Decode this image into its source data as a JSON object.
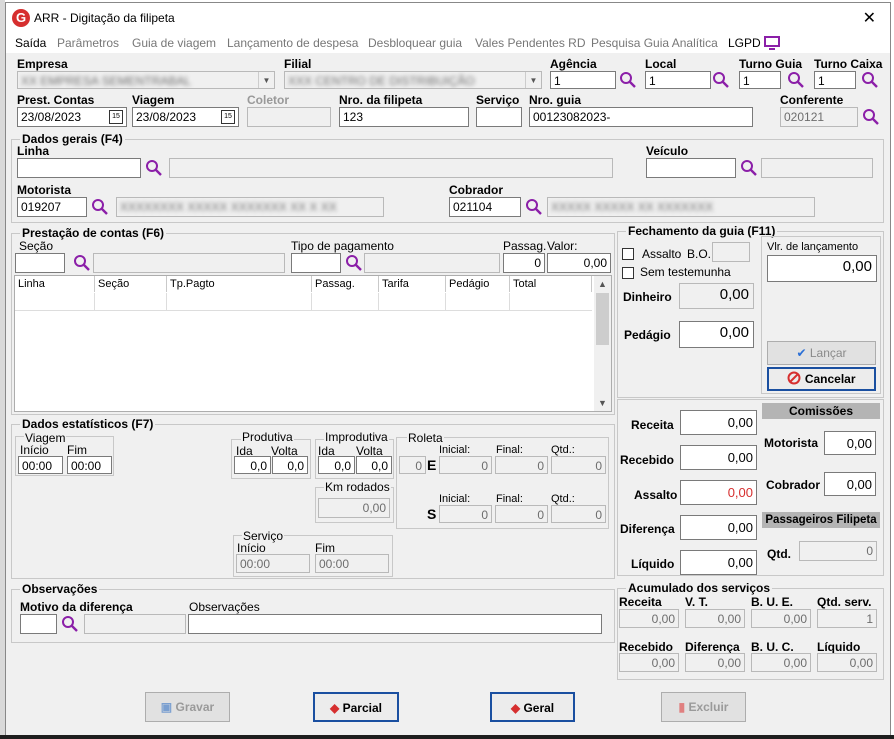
{
  "window": {
    "title": "ARR - Digitação da filipeta",
    "close": "✕"
  },
  "menu": [
    "Saída",
    "Parâmetros",
    "Guia de viagem",
    "Lançamento de despesa",
    "Desbloquear guia",
    "Vales Pendentes RD",
    "Pesquisa Guia Analítica",
    "LGPD"
  ],
  "header": {
    "empresa_label": "Empresa",
    "empresa_value": "XX EMPRESA SEMENTRABAL",
    "filial_label": "Filial",
    "filial_value": "XXX CENTRO DE DISTRIBUIÇÃO",
    "agencia_label": "Agência",
    "agencia_value": "1",
    "local_label": "Local",
    "local_value": "1",
    "turno_guia_label": "Turno Guia",
    "turno_guia_value": "1",
    "turno_caixa_label": "Turno Caixa",
    "turno_caixa_value": "1",
    "prest_label": "Prest. Contas",
    "prest_value": "23/08/2023",
    "viagem_label": "Viagem",
    "viagem_value": "23/08/2023",
    "coletor_label": "Coletor",
    "nro_filipeta_label": "Nro. da filipeta",
    "nro_filipeta_value": "123",
    "servico_label": "Serviço",
    "nro_guia_label": "Nro. guia",
    "nro_guia_value": "00123082023-",
    "conferente_label": "Conferente",
    "conferente_value": "020121"
  },
  "dados_gerais": {
    "title": "Dados gerais (F4)",
    "linha_label": "Linha",
    "veiculo_label": "Veículo",
    "motorista_label": "Motorista",
    "motorista_value": "019207",
    "motorista_name": "XXXXXXXX XXXXX XXXXXXX XX X XX",
    "cobrador_label": "Cobrador",
    "cobrador_value": "021104",
    "cobrador_name": "XXXXX XXXXX XX XXXXXXX"
  },
  "prestacao": {
    "title": "Prestação de contas (F6)",
    "secao_label": "Seção",
    "tipo_pag_label": "Tipo de pagamento",
    "passag_label": "Passag.",
    "passag_value": "0",
    "valor_label": "Valor:",
    "valor_value": "0,00",
    "columns": [
      "Linha",
      "Seção",
      "Tp.Pagto",
      "Passag.",
      "Tarifa",
      "Pedágio",
      "Total"
    ]
  },
  "fechamento": {
    "title": "Fechamento da guia (F11)",
    "assalto_label": "Assalto",
    "bo_label": "B.O.",
    "sem_test_label": "Sem testemunha",
    "dinheiro_label": "Dinheiro",
    "dinheiro_value": "0,00",
    "pedagio_label": "Pedágio",
    "pedagio_value": "0,00",
    "vlr_lanc_label": "Vlr. de lançamento",
    "vlr_lanc_value": "0,00",
    "lancar_label": "Lançar",
    "cancelar_label": "Cancelar"
  },
  "totais": {
    "receita_label": "Receita",
    "receita_value": "0,00",
    "recebido_label": "Recebido",
    "recebido_value": "0,00",
    "assalto_label": "Assalto",
    "assalto_value": "0,00",
    "diferenca_label": "Diferença",
    "diferenca_value": "0,00",
    "liquido_label": "Líquido",
    "liquido_value": "0,00",
    "comissoes_title": "Comissões",
    "motorista_label": "Motorista",
    "motorista_value": "0,00",
    "cobrador_label": "Cobrador",
    "cobrador_value": "0,00",
    "passageiros_title": "Passageiros Filipeta",
    "qtd_label": "Qtd.",
    "qtd_value": "0"
  },
  "estatisticos": {
    "title": "Dados estatísticos (F7)",
    "viagem_label": "Viagem",
    "inicio_label": "Início",
    "fim_label": "Fim",
    "inicio_value": "00:00",
    "fim_value": "00:00",
    "produtiva_label": "Produtiva",
    "improdutiva_label": "Improdutiva",
    "ida_label": "Ida",
    "volta_label": "Volta",
    "prod_ida": "0,0",
    "prod_volta": "0,0",
    "improd_ida": "0,0",
    "improd_volta": "0,0",
    "km_label": "Km rodados",
    "km_value": "0,00",
    "roleta_label": "Roleta",
    "roleta_value": "0",
    "e_label": "E",
    "s_label": "S",
    "inicial_label": "Inicial:",
    "final_label": "Final:",
    "qtd_label": "Qtd.:",
    "e_inicial": "0",
    "e_final": "0",
    "e_qtd": "0",
    "s_inicial": "0",
    "s_final": "0",
    "s_qtd": "0",
    "servico_label": "Serviço",
    "serv_inicio_label": "Início",
    "serv_fim_label": "Fim",
    "serv_inicio": "00:00",
    "serv_fim": "00:00"
  },
  "observacoes": {
    "title": "Observações",
    "motivo_label": "Motivo da diferença",
    "obs_label": "Observações"
  },
  "acumulado": {
    "title": "Acumulado dos serviços",
    "receita_label": "Receita",
    "receita_value": "0,00",
    "vt_label": "V. T.",
    "vt_value": "0,00",
    "bue_label": "B. U. E.",
    "bue_value": "0,00",
    "qtd_serv_label": "Qtd. serv.",
    "qtd_serv_value": "1",
    "recebido_label": "Recebido",
    "recebido_value": "0,00",
    "diferenca_label": "Diferença",
    "diferenca_value": "0,00",
    "buc_label": "B. U. C.",
    "buc_value": "0,00",
    "liquido_label": "Líquido",
    "liquido_value": "0,00"
  },
  "buttons": {
    "gravar": "Gravar",
    "parcial": "Parcial",
    "geral": "Geral",
    "excluir": "Excluir"
  },
  "colors": {
    "accent": "#1a4fa0",
    "search": "#8b1fa8",
    "danger": "#d62f2f"
  }
}
